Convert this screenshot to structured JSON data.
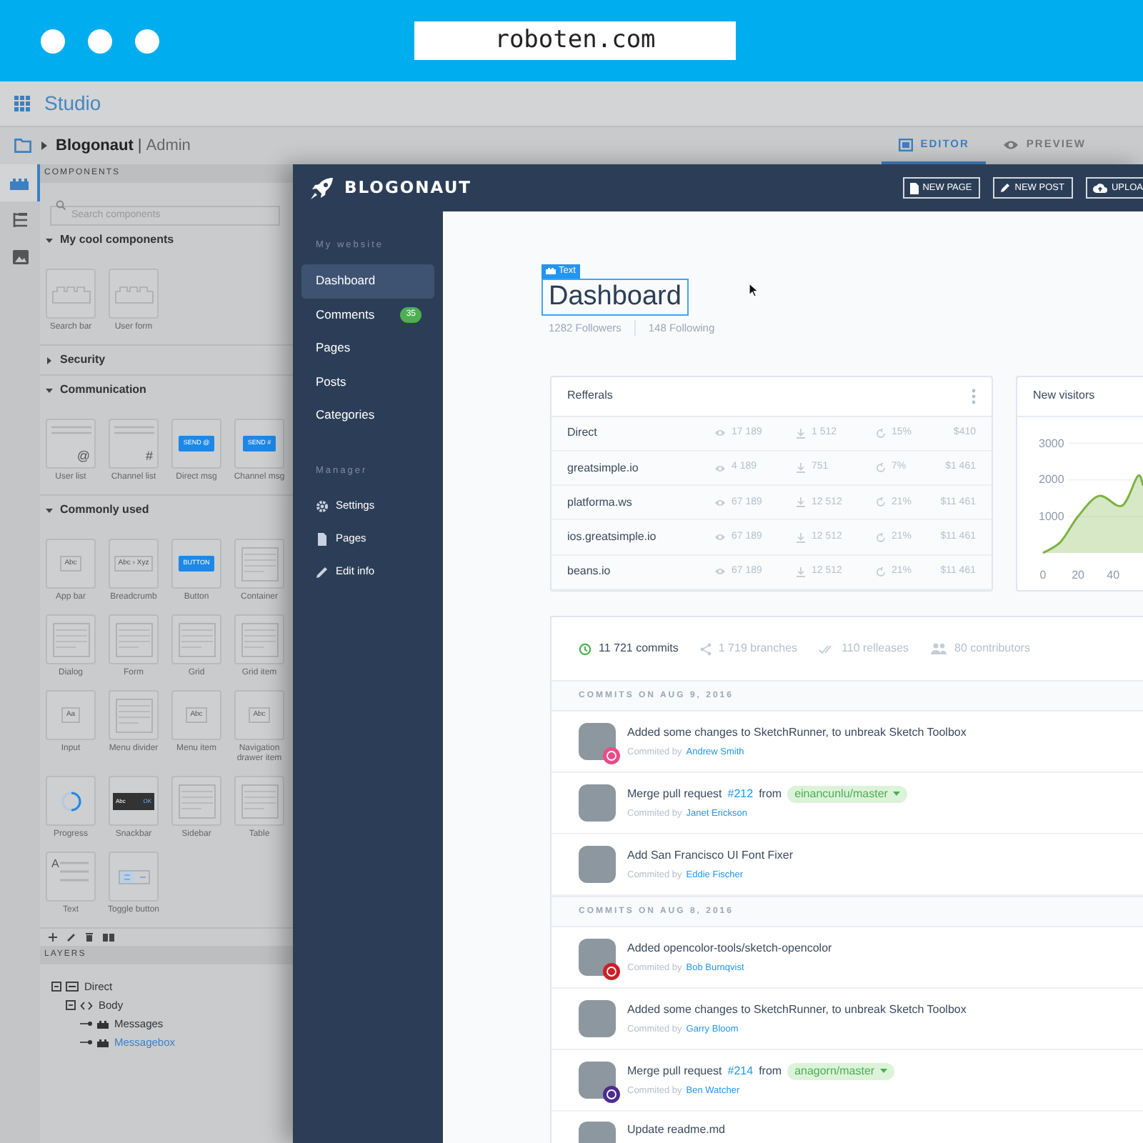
{
  "browser": {
    "url": "roboten.com"
  },
  "studio": {
    "title": "Studio",
    "breadcrumb": {
      "project": "Blogonaut",
      "separator": "|",
      "section": "Admin"
    },
    "view_tabs": [
      {
        "label": "EDITOR",
        "kind": "editor",
        "selected": true
      },
      {
        "label": "PREVIEW",
        "kind": "preview",
        "selected": false
      }
    ],
    "rail": [
      {
        "kind": "components",
        "selected": true
      },
      {
        "kind": "layers",
        "selected": false
      },
      {
        "kind": "images",
        "selected": false
      }
    ],
    "components": {
      "title": "COMPONENTS",
      "search": {
        "placeholder": "Search components"
      },
      "sections": [
        {
          "title": "My cool components",
          "expanded": true,
          "items": [
            {
              "label": "Search bar",
              "kind": "block"
            },
            {
              "label": "User form",
              "kind": "block"
            }
          ]
        },
        {
          "title": "Security",
          "expanded": false
        },
        {
          "title": "Communication",
          "expanded": true,
          "items": [
            {
              "label": "User list",
              "kind": "list",
              "preview": "@"
            },
            {
              "label": "Channel list",
              "kind": "list",
              "preview": "#"
            },
            {
              "label": "Direct msg",
              "kind": "button",
              "preview": "SEND @"
            },
            {
              "label": "Channel msg",
              "kind": "button",
              "preview": "SEND #"
            }
          ]
        },
        {
          "title": "Commonly used",
          "expanded": true,
          "items": [
            {
              "label": "App bar",
              "kind": "text",
              "preview": "Abc"
            },
            {
              "label": "Breadcrumb",
              "kind": "text",
              "preview": "Abc › Xyz"
            },
            {
              "label": "Button",
              "kind": "button",
              "preview": "BUTTON"
            },
            {
              "label": "Container",
              "kind": "lines"
            },
            {
              "label": "Dialog",
              "kind": "lines"
            },
            {
              "label": "Form",
              "kind": "lines"
            },
            {
              "label": "Grid",
              "kind": "lines"
            },
            {
              "label": "Grid item",
              "kind": "lines"
            },
            {
              "label": "Input",
              "kind": "text",
              "preview": "Aa"
            },
            {
              "label": "Menu divider",
              "kind": "lines"
            },
            {
              "label": "Menu item",
              "kind": "text",
              "preview": "Abc"
            },
            {
              "label": "Navigation drawer item",
              "kind": "text",
              "preview": "Abc"
            },
            {
              "label": "Progress",
              "kind": "progress"
            },
            {
              "label": "Snackbar",
              "kind": "snackbar",
              "preview": "Abc",
              "action": "OK"
            },
            {
              "label": "Sidebar",
              "kind": "lines"
            },
            {
              "label": "Table",
              "kind": "lines"
            },
            {
              "label": "Text",
              "kind": "textblock",
              "preview": "A"
            },
            {
              "label": "Toggle button",
              "kind": "toggle"
            }
          ]
        }
      ]
    },
    "layers": {
      "title": "LAYERS",
      "tree": [
        {
          "label": "Direct",
          "kind": "frame",
          "expanded": true,
          "selected": false,
          "children": [
            {
              "label": "Body",
              "kind": "code",
              "expanded": true,
              "selected": false,
              "children": [
                {
                  "label": "Messages",
                  "kind": "component",
                  "selected": false
                },
                {
                  "label": "Messagebox",
                  "kind": "component",
                  "selected": true
                }
              ]
            }
          ]
        }
      ]
    }
  },
  "app": {
    "brand": "BLOGONAUT",
    "header_buttons": [
      {
        "label": "NEW PAGE",
        "kind": "page"
      },
      {
        "label": "NEW POST",
        "kind": "post"
      },
      {
        "label": "UPLOA",
        "kind": "upload"
      }
    ],
    "sidebar": {
      "sections": [
        {
          "title": "My website",
          "items": [
            {
              "label": "Dashboard",
              "kind": "plain",
              "selected": true
            },
            {
              "label": "Comments",
              "kind": "plain",
              "selected": false,
              "badge": "35"
            },
            {
              "label": "Pages",
              "kind": "plain",
              "selected": false
            },
            {
              "label": "Posts",
              "kind": "plain",
              "selected": false
            },
            {
              "label": "Categories",
              "kind": "plain",
              "selected": false
            }
          ]
        },
        {
          "title": "Manager",
          "items": [
            {
              "label": "Settings",
              "kind": "settings",
              "selected": false
            },
            {
              "label": "Pages",
              "kind": "pages",
              "selected": false
            },
            {
              "label": "Edit info",
              "kind": "edit",
              "selected": false
            }
          ]
        }
      ]
    },
    "page": {
      "tag": "Text",
      "title": "Dashboard",
      "followers": "1282 Followers",
      "following": "148 Following"
    },
    "referrals": {
      "title": "Refferals",
      "rows": [
        {
          "source": "Direct",
          "views": "17 189",
          "downloads": "1 512",
          "rate": "15%",
          "revenue": "$410"
        },
        {
          "source": "greatsimple.io",
          "views": "4 189",
          "downloads": "751",
          "rate": "7%",
          "revenue": "$1 461"
        },
        {
          "source": "platforma.ws",
          "views": "67 189",
          "downloads": "12 512",
          "rate": "21%",
          "revenue": "$11 461"
        },
        {
          "source": "ios.greatsimple.io",
          "views": "67 189",
          "downloads": "12 512",
          "rate": "21%",
          "revenue": "$11 461"
        },
        {
          "source": "beans.io",
          "views": "67 189",
          "downloads": "12 512",
          "rate": "21%",
          "revenue": "$11 461"
        }
      ]
    },
    "visitors": {
      "chart_data": {
        "type": "area",
        "x": [
          0,
          10,
          20,
          32,
          45,
          54,
          57
        ],
        "series": [
          {
            "name": "New visitors",
            "color": "#7cb342",
            "values": [
              0,
              300,
              1000,
              1560,
              1290,
              2100,
              1850
            ]
          }
        ],
        "xlim": [
          0,
          57
        ],
        "ylim": [
          0,
          3000
        ],
        "xticks": [
          0,
          20,
          40
        ],
        "yticks": [
          1000,
          2000,
          3000
        ]
      }
    },
    "commits": {
      "stats": [
        {
          "label": "11 721 commits",
          "kind": "commits",
          "selected": true
        },
        {
          "label": "1 719 branches",
          "kind": "branches",
          "selected": false
        },
        {
          "label": "110 relleases",
          "kind": "releases",
          "selected": false
        },
        {
          "label": "80 contributors",
          "kind": "contributors",
          "selected": false
        }
      ],
      "groups": [
        {
          "title": "COMMITS ON AUG 9, 2016",
          "commits": [
            {
              "kind": "plain",
              "message": "Added some changes to SketchRunner, to unbreak Sketch Toolbox",
              "by": "Commited by",
              "author": "Andrew Smith",
              "color": "#ea4c89"
            },
            {
              "kind": "merge",
              "message": "Merge pull request",
              "pr": "#212",
              "from": "from",
              "branch": "einancunlu/master",
              "by": "Commited by",
              "author": "Janet Erickson"
            },
            {
              "kind": "plain",
              "message": "Add San Francisco UI Font Fixer",
              "by": "Commited by",
              "author": "Eddie Fischer"
            }
          ]
        },
        {
          "title": "COMMITS ON AUG 8, 2016",
          "commits": [
            {
              "kind": "plain",
              "message": "Added opencolor-tools/sketch-opencolor",
              "by": "Commited by",
              "author": "Bob Burnqvist",
              "color": "#cb2027"
            },
            {
              "kind": "plain",
              "message": "Added some changes to SketchRunner, to unbreak Sketch Toolbox",
              "by": "Commited by",
              "author": "Garry Bloom"
            },
            {
              "kind": "merge",
              "message": "Merge pull request",
              "pr": "#214",
              "from": "from",
              "branch": "anagorn/master",
              "by": "Commited by",
              "author": "Ben Watcher",
              "color": "#4a2d8c"
            },
            {
              "kind": "plain",
              "message": "Update readme.md"
            }
          ]
        }
      ]
    }
  }
}
